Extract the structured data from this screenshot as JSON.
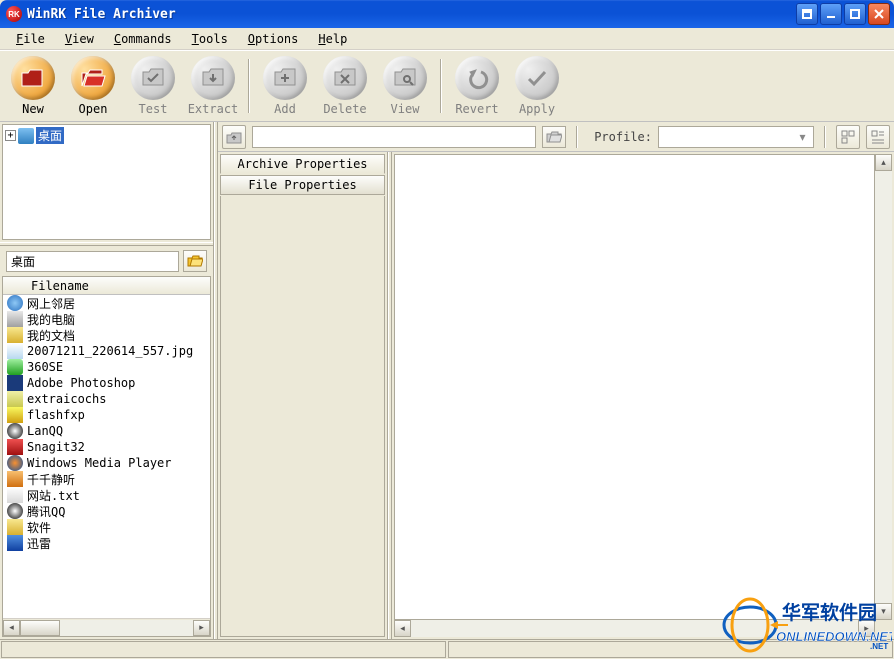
{
  "window": {
    "title": "WinRK File Archiver",
    "icon_label": "RK"
  },
  "menu": {
    "items": [
      "File",
      "View",
      "Commands",
      "Tools",
      "Options",
      "Help"
    ]
  },
  "toolbar": {
    "buttons": [
      {
        "label": "New",
        "icon": "folder-new",
        "colored": true
      },
      {
        "label": "Open",
        "icon": "folder-open",
        "colored": true
      },
      {
        "label": "Test",
        "icon": "check",
        "colored": false
      },
      {
        "label": "Extract",
        "icon": "extract",
        "colored": false
      },
      {
        "sep": true
      },
      {
        "label": "Add",
        "icon": "add",
        "colored": false
      },
      {
        "label": "Delete",
        "icon": "delete",
        "colored": false
      },
      {
        "label": "View",
        "icon": "view",
        "colored": false
      },
      {
        "sep": true
      },
      {
        "label": "Revert",
        "icon": "undo",
        "colored": false
      },
      {
        "label": "Apply",
        "icon": "apply",
        "colored": false
      }
    ]
  },
  "tree": {
    "root_label": "桌面"
  },
  "path_input": {
    "value": "桌面"
  },
  "filelist": {
    "header": "Filename",
    "rows": [
      {
        "icon": "ic-net",
        "name": "网上邻居"
      },
      {
        "icon": "ic-pc",
        "name": "我的电脑"
      },
      {
        "icon": "ic-docs",
        "name": "我的文档"
      },
      {
        "icon": "ic-img",
        "name": "20071211_220614_557.jpg"
      },
      {
        "icon": "ic-se",
        "name": "360SE"
      },
      {
        "icon": "ic-ps",
        "name": "Adobe Photoshop"
      },
      {
        "icon": "ic-app",
        "name": "extraicochs"
      },
      {
        "icon": "ic-fxp",
        "name": "flashfxp"
      },
      {
        "icon": "ic-qq",
        "name": "LanQQ"
      },
      {
        "icon": "ic-snag",
        "name": "Snagit32"
      },
      {
        "icon": "ic-wmp",
        "name": "Windows Media Player"
      },
      {
        "icon": "ic-mus",
        "name": "千千静听"
      },
      {
        "icon": "ic-txt",
        "name": "网站.txt"
      },
      {
        "icon": "ic-qq",
        "name": "腾讯QQ"
      },
      {
        "icon": "ic-fold",
        "name": "软件"
      },
      {
        "icon": "ic-xl",
        "name": "迅雷"
      }
    ]
  },
  "profile": {
    "label": "Profile:",
    "value": ""
  },
  "props": {
    "archive_tab": "Archive Properties",
    "file_tab": "File Properties"
  },
  "watermark": {
    "text_cn": "华军软件园",
    "text_en": "ONLINEDOWN.NET"
  }
}
